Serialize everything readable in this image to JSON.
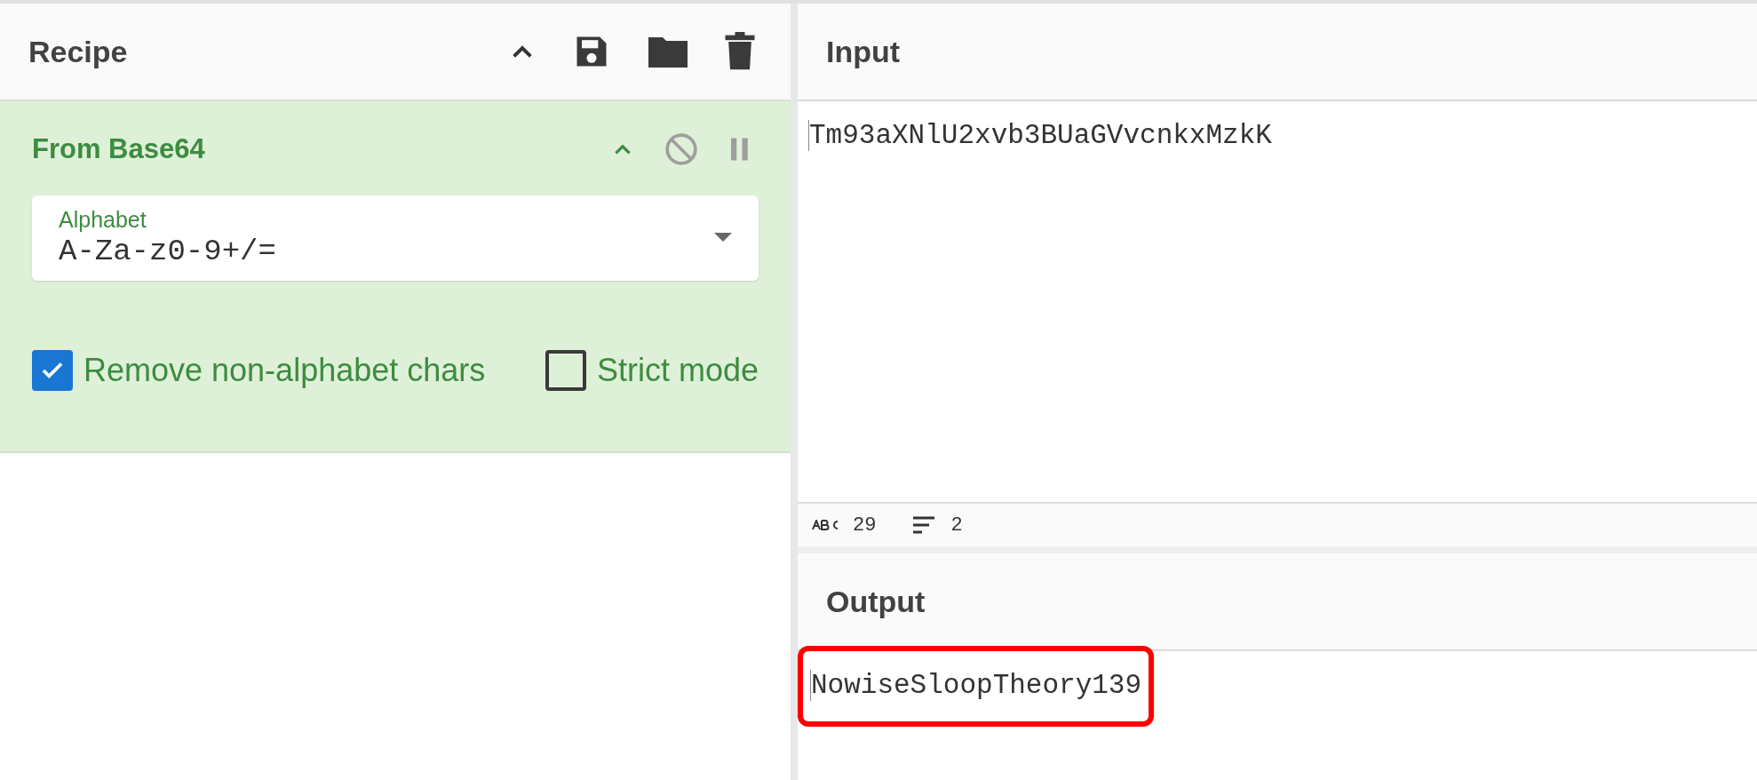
{
  "recipe": {
    "title": "Recipe",
    "operations": [
      {
        "name": "From Base64",
        "expanded": true,
        "disabled": false,
        "paused": false,
        "alphabet": {
          "label": "Alphabet",
          "value": "A-Za-z0-9+/="
        },
        "options": [
          {
            "label": "Remove non-alphabet chars",
            "checked": true
          },
          {
            "label": "Strict mode",
            "checked": false
          }
        ]
      }
    ]
  },
  "input": {
    "title": "Input",
    "value": "Tm93aXNlU2xvb3BUaGVvcnkxMzkK",
    "status": {
      "length": "29",
      "lines": "2"
    }
  },
  "output": {
    "title": "Output",
    "value": "NowiseSloopTheory139",
    "highlighted": true
  }
}
